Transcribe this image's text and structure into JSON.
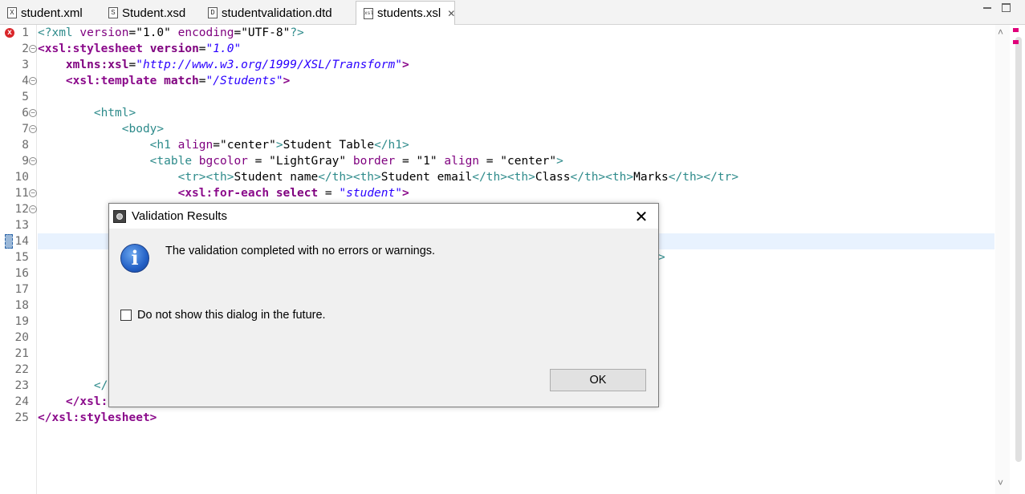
{
  "tabs": [
    {
      "icon": "X",
      "label": "student.xml",
      "active": false
    },
    {
      "icon": "S",
      "label": "Student.xsd",
      "active": false
    },
    {
      "icon": "D",
      "label": "studentvalidation.dtd",
      "active": false
    },
    {
      "icon": "xsl",
      "label": "students.xsl",
      "active": true,
      "close": "✕"
    }
  ],
  "editor": {
    "line_numbers": [
      "1",
      "2",
      "3",
      "4",
      "5",
      "6",
      "7",
      "8",
      "9",
      "10",
      "11",
      "12",
      "13",
      "14",
      "15",
      "16",
      "17",
      "18",
      "19",
      "20",
      "21",
      "22",
      "23",
      "24",
      "25"
    ],
    "error_marker": "x",
    "lines": {
      "l1_a": "<?xml ",
      "l1_b": "version",
      "l1_c": "=",
      "l1_d": "\"1.0\"",
      "l1_e": " encoding",
      "l1_f": "=",
      "l1_g": "\"UTF-8\"",
      "l1_h": "?>",
      "l2_a": "<xsl:stylesheet ",
      "l2_b": "version",
      "l2_c": "=",
      "l2_d": "\"1.0\"",
      "l3_a": "    xmlns:xsl",
      "l3_b": "=",
      "l3_c": "\"http://www.w3.org/1999/XSL/Transform\"",
      "l3_d": ">",
      "l4_a": "    <xsl:template ",
      "l4_b": "match",
      "l4_c": "=",
      "l4_d": "\"/Students\"",
      "l4_e": ">",
      "l6": "        <html>",
      "l7": "            <body>",
      "l8_a": "                <h1 ",
      "l8_b": "align",
      "l8_c": "=",
      "l8_d": "\"center\"",
      "l8_e": ">",
      "l8_f": "Student Table",
      "l8_g": "</h1>",
      "l9_a": "                <table ",
      "l9_b": "bgcolor",
      "l9_c": " = ",
      "l9_d": "\"LightGray\"",
      "l9_e": " border",
      "l9_f": " = ",
      "l9_g": "\"1\"",
      "l9_h": " align",
      "l9_i": " = ",
      "l9_j": "\"center\"",
      "l9_k": ">",
      "l10_a": "                    <tr><th>",
      "l10_b": "Student name",
      "l10_c": "</th><th>",
      "l10_d": "Student email",
      "l10_e": "</th><th>",
      "l10_f": "Class",
      "l10_g": "</th><th>",
      "l10_h": "Marks",
      "l10_i": "</th></tr>",
      "l11_a": "                    <xsl:for-each ",
      "l11_b": "select",
      "l11_c": " = ",
      "l11_d": "\"student\"",
      "l11_e": ">",
      "l15_tail": ">",
      "l23": "        </",
      "l24": "    </xsl:",
      "l25": "</xsl:stylesheet>"
    }
  },
  "dialog": {
    "title": "Validation Results",
    "close": "✕",
    "message": "The validation completed with no errors or warnings.",
    "checkbox_label": "Do not show this dialog in the future.",
    "checkbox_checked": false,
    "ok": "OK",
    "info_glyph": "i"
  },
  "scroll": {
    "up": "˄",
    "down": "˅"
  },
  "colors": {
    "tag": "#2e8b8b",
    "xsl_tag": "#8b0a8b",
    "attr": "#7f007f",
    "string": "#2a00ff",
    "error": "#d9262a",
    "current_line": "#e8f2fe"
  }
}
